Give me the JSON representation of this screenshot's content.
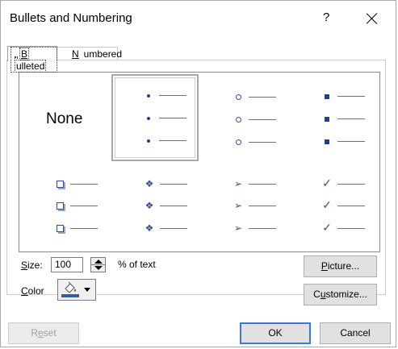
{
  "window": {
    "title": "Bullets and Numbering",
    "help": "?"
  },
  "tabs": [
    {
      "pre": "",
      "mnemonic": "B",
      "post": "ulleted"
    },
    {
      "pre": "",
      "mnemonic": "N",
      "post": "umbered"
    }
  ],
  "gallery": {
    "none_label": "None",
    "styles": [
      "None",
      "small-dot-bullet-icon",
      "hollow-circle-bullet-icon",
      "square-bullet-icon",
      "shadow-box-bullet-icon",
      "four-diamond-bullet-icon",
      "arrowhead-bullet-icon",
      "checkmark-bullet-icon"
    ],
    "selected": "small-dot-bullet-icon",
    "glyphs": {
      "diamonds": "❖",
      "arrow": "➢",
      "check": "✓"
    }
  },
  "size": {
    "pre": "",
    "mnemonic": "S",
    "post": "ize:",
    "value": "100",
    "unit": "% of text"
  },
  "color": {
    "pre": "",
    "mnemonic": "C",
    "post": "olor",
    "swatch": "#2e5ea8"
  },
  "buttons": {
    "picture": {
      "pre": "",
      "mnemonic": "P",
      "post": "icture..."
    },
    "customize": {
      "pre": "C",
      "mnemonic": "u",
      "post": "stomize..."
    },
    "reset": {
      "pre": "R",
      "mnemonic": "e",
      "post": "set"
    },
    "ok": "OK",
    "cancel": "Cancel"
  },
  "colors": {
    "accent": "#3c78d8",
    "bullet": "#1f3f8f"
  }
}
